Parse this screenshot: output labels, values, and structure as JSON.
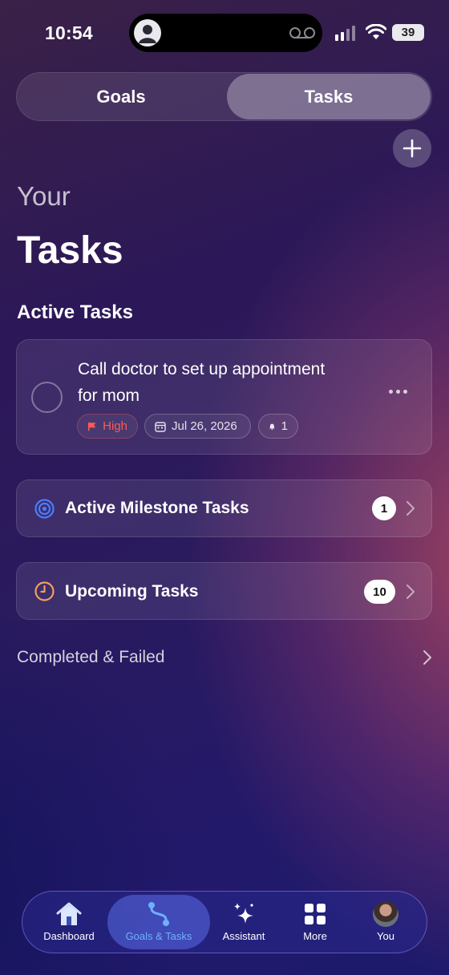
{
  "status_bar": {
    "time": "10:54",
    "battery": "39"
  },
  "segment": {
    "goals_label": "Goals",
    "tasks_label": "Tasks",
    "selected": "Tasks"
  },
  "header": {
    "eyebrow": "Your",
    "title": "Tasks"
  },
  "active_section": {
    "title": "Active Tasks"
  },
  "tasks": [
    {
      "title": "Call doctor to set up appointment for mom",
      "priority": "High",
      "due_date": "Jul 26, 2026",
      "reminders": "1"
    }
  ],
  "rows": {
    "milestone": {
      "label": "Active Milestone Tasks",
      "count": "1"
    },
    "upcoming": {
      "label": "Upcoming Tasks",
      "count": "10"
    }
  },
  "completed": {
    "label": "Completed & Failed"
  },
  "tabbar": {
    "items": [
      {
        "label": "Dashboard",
        "icon": "home-icon"
      },
      {
        "label": "Goals & Tasks",
        "icon": "route-icon"
      },
      {
        "label": "Assistant",
        "icon": "sparkles-icon"
      },
      {
        "label": "More",
        "icon": "grid-icon"
      },
      {
        "label": "You",
        "icon": "avatar"
      }
    ],
    "active": "Goals & Tasks"
  },
  "colors": {
    "priority_high": "#ff5b50",
    "tab_active": "#6fb0ff",
    "milestone_icon": "#4a7dff",
    "upcoming_icon": "#f0a060"
  }
}
